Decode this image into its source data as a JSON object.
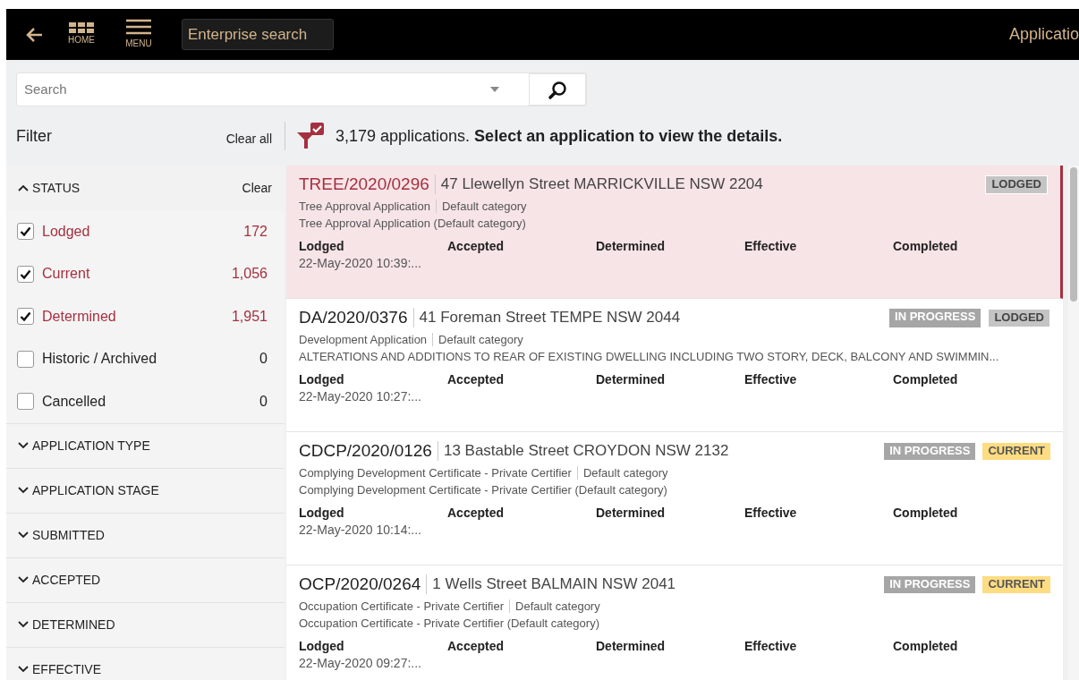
{
  "topbar": {
    "home_label": "HOME",
    "menu_label": "MENU",
    "enterprise_search": "Enterprise search",
    "title": "Applicatio"
  },
  "search": {
    "placeholder": "Search"
  },
  "filter": {
    "title": "Filter",
    "clear_all": "Clear all"
  },
  "summary": "3,179 applications. **Select an application to view the details.**",
  "status_group": {
    "title": "STATUS",
    "expanded": true,
    "clear": "Clear",
    "options": [
      {
        "label": "Lodged",
        "count": "172",
        "checked": true
      },
      {
        "label": "Current",
        "count": "1,056",
        "checked": true
      },
      {
        "label": "Determined",
        "count": "1,951",
        "checked": true
      },
      {
        "label": "Historic / Archived",
        "count": "0",
        "checked": false
      },
      {
        "label": "Cancelled",
        "count": "0",
        "checked": false
      }
    ]
  },
  "filter_groups": [
    {
      "title": "APPLICATION TYPE",
      "expanded": false
    },
    {
      "title": "APPLICATION STAGE",
      "expanded": false
    },
    {
      "title": "SUBMITTED",
      "expanded": false
    },
    {
      "title": "ACCEPTED",
      "expanded": false
    },
    {
      "title": "DETERMINED",
      "expanded": false
    },
    {
      "title": "EFFECTIVE",
      "expanded": false
    }
  ],
  "applications": [
    {
      "id": "TREE/2020/0296",
      "address": "47 Llewellyn Street MARRICKVILLE NSW 2204",
      "type": "Tree Approval Application",
      "category": "Default category",
      "description": "Tree Approval Application (Default category)",
      "selected": true,
      "badges": [
        {
          "label": "LODGED",
          "kind": "lodged"
        }
      ],
      "dates": [
        {
          "label": "Lodged",
          "value": "22-May-2020 10:39:..."
        },
        {
          "label": "Accepted"
        },
        {
          "label": "Determined"
        },
        {
          "label": "Effective"
        },
        {
          "label": "Completed"
        }
      ]
    },
    {
      "id": "DA/2020/0376",
      "address": "41 Foreman Street TEMPE NSW 2044",
      "type": "Development Application",
      "category": "Default category",
      "description": "ALTERATIONS AND ADDITIONS TO REAR OF EXISTING DWELLING INCLUDING TWO STORY, DECK, BALCONY AND SWIMMIN...",
      "selected": false,
      "badges": [
        {
          "label": "IN PROGRESS",
          "kind": "progress"
        },
        {
          "label": "LODGED",
          "kind": "lodged"
        }
      ],
      "dates": [
        {
          "label": "Lodged",
          "value": "22-May-2020 10:27:..."
        },
        {
          "label": "Accepted"
        },
        {
          "label": "Determined"
        },
        {
          "label": "Effective"
        },
        {
          "label": "Completed"
        }
      ]
    },
    {
      "id": "CDCP/2020/0126",
      "address": "13 Bastable Street CROYDON NSW 2132",
      "type": "Complying Development Certificate - Private Certifier",
      "category": "Default category",
      "description": "Complying Development Certificate - Private Certifier (Default category)",
      "selected": false,
      "badges": [
        {
          "label": "IN PROGRESS",
          "kind": "progress"
        },
        {
          "label": "CURRENT",
          "kind": "current"
        }
      ],
      "dates": [
        {
          "label": "Lodged",
          "value": "22-May-2020 10:14:..."
        },
        {
          "label": "Accepted"
        },
        {
          "label": "Determined"
        },
        {
          "label": "Effective"
        },
        {
          "label": "Completed"
        }
      ]
    },
    {
      "id": "OCP/2020/0264",
      "address": "1 Wells Street BALMAIN NSW 2041",
      "type": "Occupation Certificate - Private Certifier",
      "category": "Default category",
      "description": "Occupation Certificate - Private Certifier (Default category)",
      "selected": false,
      "badges": [
        {
          "label": "IN PROGRESS",
          "kind": "progress"
        },
        {
          "label": "CURRENT",
          "kind": "current"
        }
      ],
      "dates": [
        {
          "label": "Lodged",
          "value": "22-May-2020 09:27:..."
        },
        {
          "label": "Accepted"
        },
        {
          "label": "Determined"
        },
        {
          "label": "Effective"
        },
        {
          "label": "Completed"
        }
      ]
    }
  ]
}
